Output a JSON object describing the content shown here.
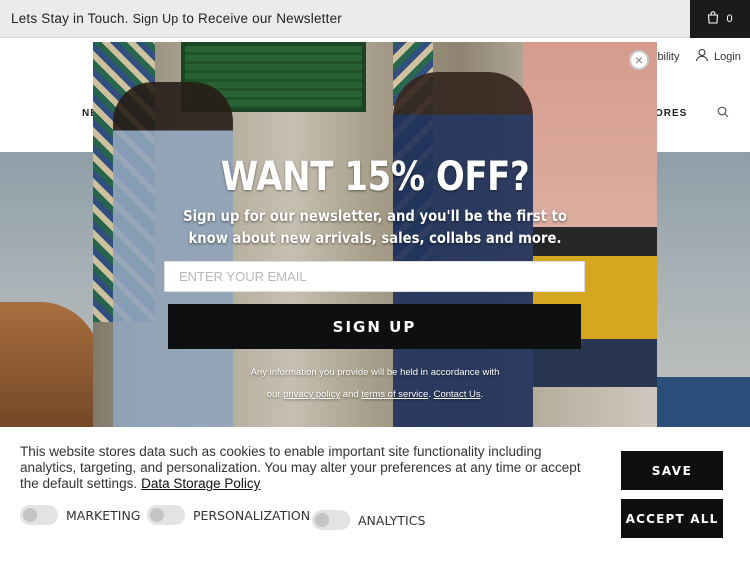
{
  "topbar": {
    "message_prefix": "Lets Stay in Touch.",
    "message_link": "Sign Up",
    "message_suffix": "to Receive our Newsletter",
    "cart_count": "0"
  },
  "header": {
    "accessibility_label": "ibility",
    "login_label": "Login",
    "nav_left_fragment": "NE",
    "nav_right_fragment": "ORES"
  },
  "popup": {
    "title": "WANT 15% OFF?",
    "subtitle": "Sign up for our newsletter, and you'll be the first to know about new arrivals, sales, collabs and more.",
    "email_placeholder": "ENTER YOUR EMAIL",
    "email_value": "",
    "signup_label": "SIGN UP",
    "fine_print_1": "Any information you provide will be held in accordance with",
    "fine_print_our": "our",
    "privacy_link": "privacy policy",
    "fine_print_and": "and",
    "terms_link": "terms of service",
    "contact_link": "Contact Us"
  },
  "cookie": {
    "text": "This website stores data such as cookies to enable important site functionality including analytics, targeting, and personalization. You may alter your preferences at any time or accept the default settings.",
    "policy_link": "Data Storage Policy",
    "toggles": [
      {
        "label": "MARKETING",
        "checked": false
      },
      {
        "label": "PERSONALIZATION",
        "checked": false
      },
      {
        "label": "ANALYTICS",
        "checked": false
      }
    ],
    "save_label": "SAVE",
    "accept_label": "ACCEPT ALL"
  },
  "icons": {
    "cart": "bag-icon",
    "login": "user-icon",
    "search": "search-icon",
    "close": "close-icon"
  }
}
